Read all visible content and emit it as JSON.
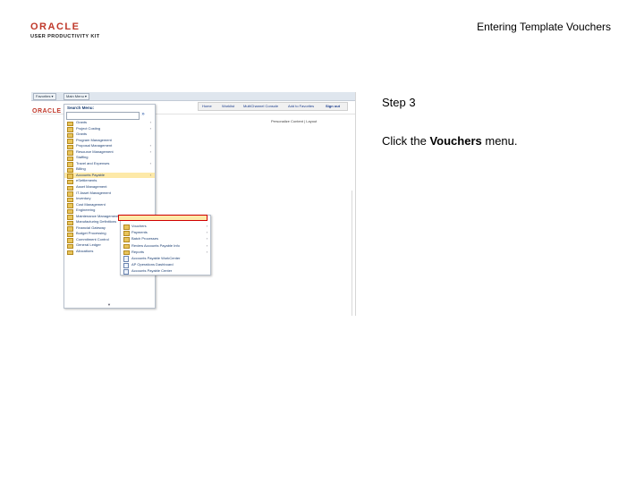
{
  "header": {
    "logo_brand": "ORACLE",
    "logo_product": "USER PRODUCTIVITY KIT",
    "doc_title": "Entering Template Vouchers"
  },
  "instruction": {
    "step": "Step 3",
    "text_before": "Click the ",
    "target": "Vouchers",
    "text_after": " menu."
  },
  "screenshot": {
    "tabs": [
      "Favorites ▾",
      "Main Menu ▾"
    ],
    "brand": "ORACLE",
    "header_links": [
      "Home",
      "Worklist",
      "MultiChannel Console",
      "Add to Favorites",
      "Sign out"
    ],
    "personalize": "Personalize Content | Layout",
    "menu": {
      "title": "Search Menu:",
      "items": [
        {
          "label": "Grants",
          "has_sub": true
        },
        {
          "label": "Project Costing",
          "has_sub": true
        },
        {
          "label": "Grants",
          "has_sub": false
        },
        {
          "label": "Program Management",
          "has_sub": false
        },
        {
          "label": "Proposal Management",
          "has_sub": true
        },
        {
          "label": "Resource Management",
          "has_sub": true
        },
        {
          "label": "Staffing",
          "has_sub": false
        },
        {
          "label": "Travel and Expenses",
          "has_sub": true
        },
        {
          "label": "Billing",
          "has_sub": false
        },
        {
          "label": "Accounts Payable",
          "has_sub": true,
          "selected": true
        },
        {
          "label": "eSettlements",
          "has_sub": false
        },
        {
          "label": "Asset Management",
          "has_sub": false
        },
        {
          "label": "IT Asset Management",
          "has_sub": false
        },
        {
          "label": "Inventory",
          "has_sub": false
        },
        {
          "label": "Cost Management",
          "has_sub": false
        },
        {
          "label": "Engineering",
          "has_sub": false
        },
        {
          "label": "Maintenance Management",
          "has_sub": false
        },
        {
          "label": "Manufacturing Definitions",
          "has_sub": false
        },
        {
          "label": "Financial Gateway",
          "has_sub": false
        },
        {
          "label": "Budget Processing",
          "has_sub": false
        },
        {
          "label": "Commitment Control",
          "has_sub": true
        },
        {
          "label": "General Ledger",
          "has_sub": true
        },
        {
          "label": "Allocations",
          "has_sub": true
        }
      ]
    },
    "submenu": {
      "items": [
        {
          "label": "Vouchers",
          "kind": "folder",
          "has_sub": true
        },
        {
          "label": "Payments",
          "kind": "folder",
          "has_sub": true
        },
        {
          "label": "Batch Processes",
          "kind": "folder",
          "has_sub": true
        },
        {
          "label": "Review Accounts Payable Info",
          "kind": "folder",
          "has_sub": true
        },
        {
          "label": "Reports",
          "kind": "folder",
          "has_sub": true
        },
        {
          "label": "Accounts Payable WorkCenter",
          "kind": "page",
          "has_sub": false
        },
        {
          "label": "AP Operations Dashboard",
          "kind": "page",
          "has_sub": false
        },
        {
          "label": "Accounts Payable Center",
          "kind": "page",
          "has_sub": false
        }
      ]
    }
  }
}
